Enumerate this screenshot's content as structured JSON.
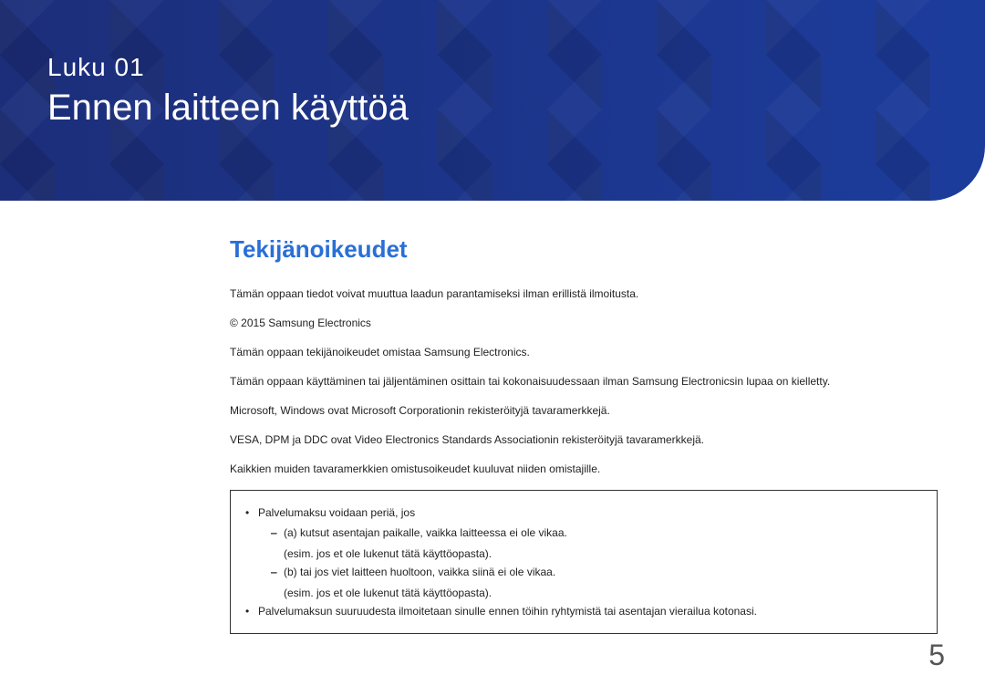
{
  "banner": {
    "chapter": "Luku 01",
    "title": "Ennen laitteen käyttöä"
  },
  "main": {
    "heading": "Tekijänoikeudet",
    "p1": "Tämän oppaan tiedot voivat muuttua laadun parantamiseksi ilman erillistä ilmoitusta.",
    "p2": "© 2015 Samsung Electronics",
    "p3": "Tämän oppaan tekijänoikeudet omistaa Samsung Electronics.",
    "p4": "Tämän oppaan käyttäminen tai jäljentäminen osittain tai kokonaisuudessaan ilman Samsung Electronicsin lupaa on kielletty.",
    "p5": "Microsoft, Windows ovat Microsoft Corporationin rekisteröityjä tavaramerkkejä.",
    "p6": "VESA, DPM ja DDC ovat Video Electronics Standards Associationin rekisteröityjä tavaramerkkejä.",
    "p7": "Kaikkien muiden tavaramerkkien omistusoikeudet kuuluvat niiden omistajille."
  },
  "notice": {
    "top1": "Palvelumaksu voidaan periä, jos",
    "sub_a": "(a) kutsut asentajan paikalle, vaikka laitteessa ei ole vikaa.",
    "sub_a_extra": "(esim. jos et ole lukenut tätä käyttöopasta).",
    "sub_b": "(b) tai jos viet laitteen huoltoon, vaikka siinä ei ole vikaa.",
    "sub_b_extra": "(esim. jos et ole lukenut tätä käyttöopasta).",
    "top2": "Palvelumaksun suuruudesta ilmoitetaan sinulle ennen töihin ryhtymistä tai asentajan vierailua kotonasi."
  },
  "page_number": "5"
}
